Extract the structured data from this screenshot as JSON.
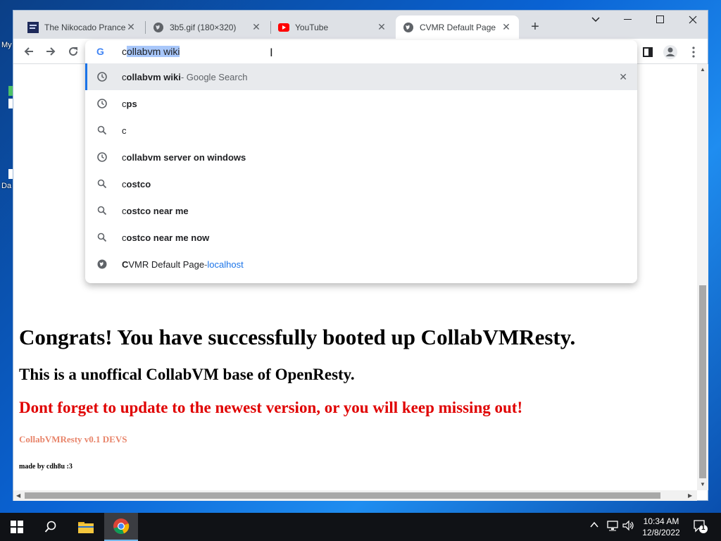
{
  "desktop": {
    "labels": [
      "My",
      "Da"
    ]
  },
  "tabs": [
    {
      "title": "The Nikocado Prance",
      "icon": "prance-favicon"
    },
    {
      "title": "3b5.gif (180×320)",
      "icon": "globe-icon"
    },
    {
      "title": "YouTube",
      "icon": "youtube-icon"
    },
    {
      "title": "CVMR Default Page",
      "icon": "globe-icon"
    }
  ],
  "omnibox": {
    "typed_prefix": "c",
    "selected_completion": "ollabvm wiki",
    "suggestions": [
      {
        "kind": "history",
        "match": "c",
        "rest": "ollabvm wiki",
        "desc": " - Google Search",
        "url": ""
      },
      {
        "kind": "history",
        "match": "c",
        "rest": "ps",
        "desc": "",
        "url": ""
      },
      {
        "kind": "search",
        "match": "c",
        "rest": "",
        "desc": "",
        "url": ""
      },
      {
        "kind": "history",
        "match": "c",
        "rest": "ollabvm server on windows",
        "desc": "",
        "url": ""
      },
      {
        "kind": "search",
        "match": "c",
        "rest": "ostco",
        "desc": "",
        "url": ""
      },
      {
        "kind": "search",
        "match": "c",
        "rest": "ostco near me",
        "desc": "",
        "url": ""
      },
      {
        "kind": "search",
        "match": "c",
        "rest": "ostco near me now",
        "desc": "",
        "url": ""
      },
      {
        "kind": "page",
        "match": "C",
        "rest": "VMR Default Page",
        "desc": " - ",
        "url": "localhost"
      }
    ]
  },
  "page": {
    "heading": "Congrats! You have successfully booted up CollabVMResty.",
    "subheading": "This is a unoffical CollabVM base of OpenResty.",
    "warning": "Dont forget to update to the newest version, or you will keep missing out!",
    "version": "CollabVMResty v0.1 DEVS",
    "credit": "made by cdh8u :3"
  },
  "clock": {
    "time": "10:34 AM",
    "date": "12/8/2022"
  },
  "tray": {
    "notification_count": "1"
  },
  "colors": {
    "accent": "#1a73e8",
    "warning": "#e00000",
    "version": "#e8846a"
  }
}
